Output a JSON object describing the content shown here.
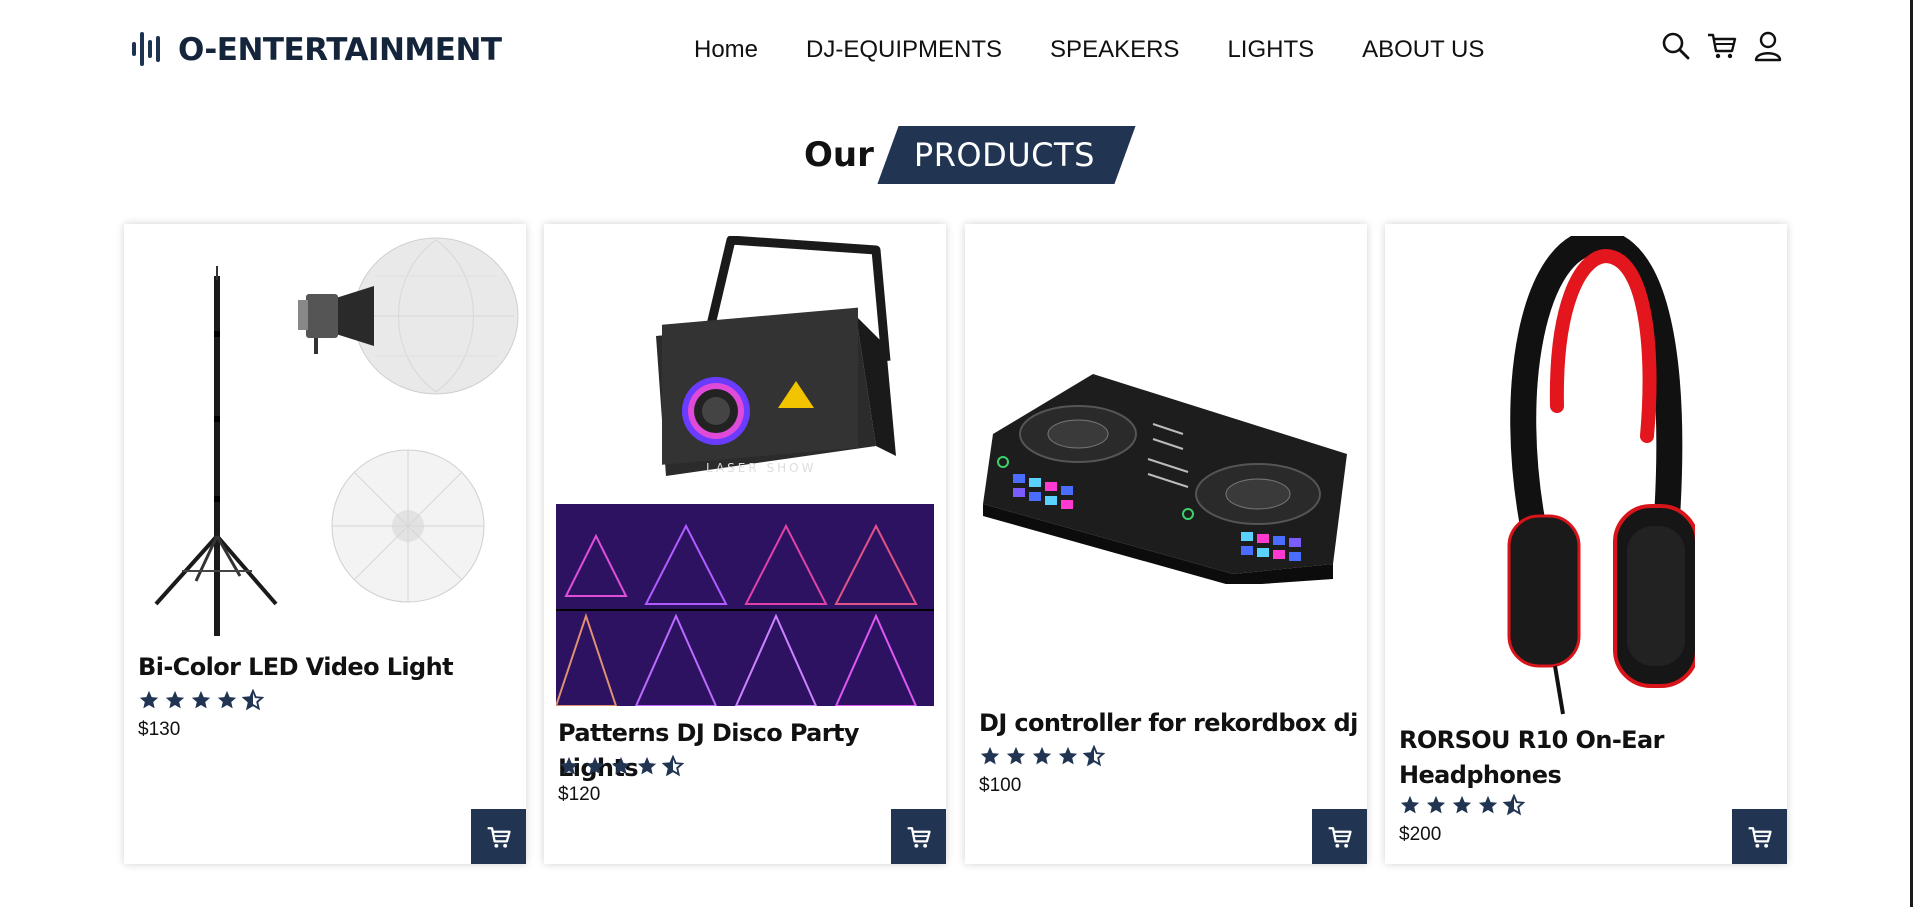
{
  "brand": {
    "name": "O-ENTERTAINMENT"
  },
  "nav": {
    "items": [
      {
        "label": "Home"
      },
      {
        "label": "DJ-EQUIPMENTS"
      },
      {
        "label": "SPEAKERS"
      },
      {
        "label": "LIGHTS"
      },
      {
        "label": "ABOUT US"
      }
    ]
  },
  "header_icons": [
    "search-icon",
    "cart-icon",
    "user-icon"
  ],
  "section": {
    "title_plain": "Our",
    "title_badge": "PRODUCTS"
  },
  "products": [
    {
      "name": "Bi-Color LED Video Light",
      "rating": 4.5,
      "price": "$130",
      "image": "light-stand-softbox-image"
    },
    {
      "name": "Patterns DJ Disco Party Lights",
      "rating": 4.5,
      "price": "$120",
      "image": "laser-show-projector-image"
    },
    {
      "name": "DJ controller for rekordbox dj",
      "rating": 4.5,
      "price": "$100",
      "image": "dj-controller-image"
    },
    {
      "name": "RORSOU R10 On-Ear Headphones",
      "rating": 4.5,
      "price": "$200",
      "image": "red-black-headphones-image"
    }
  ],
  "colors": {
    "accent": "#213553",
    "text": "#111111",
    "background": "#ffffff"
  }
}
